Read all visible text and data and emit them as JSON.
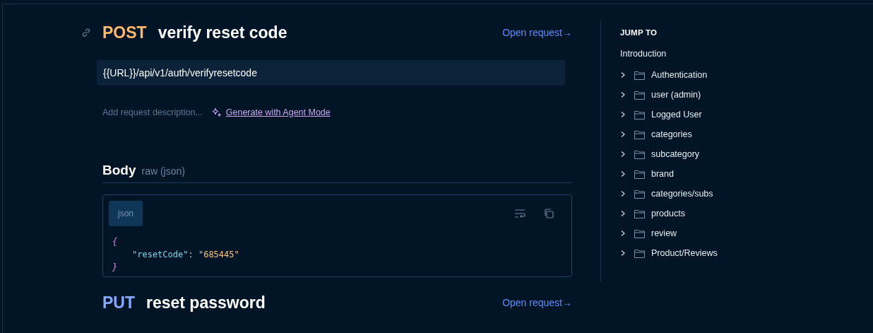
{
  "requests": [
    {
      "method": "POST",
      "name": "verify reset code",
      "open_link": "Open request→",
      "url": "{{URL}}/api/v1/auth/verifyresetcode",
      "description_placeholder": "Add request description...",
      "agent_link": "Generate with Agent Mode",
      "body": {
        "title": "Body",
        "mode": "raw (json)",
        "language": "json",
        "lines": [
          [
            {
              "kind": "brace",
              "text": "{"
            }
          ],
          [
            {
              "kind": "key",
              "text": "\"resetCode\""
            },
            {
              "kind": "punct",
              "text": ": "
            },
            {
              "kind": "string",
              "text": "\"685445\""
            }
          ],
          [
            {
              "kind": "brace",
              "text": "}"
            }
          ]
        ]
      }
    },
    {
      "method": "PUT",
      "name": "reset password",
      "open_link": "Open request→"
    }
  ],
  "sidebar": {
    "heading": "JUMP TO",
    "intro": "Introduction",
    "items": [
      {
        "label": "Authentication",
        "expanded": false
      },
      {
        "label": "user (admin)",
        "expanded": false
      },
      {
        "label": "Logged User",
        "expanded": false
      },
      {
        "label": "categories",
        "expanded": false
      },
      {
        "label": "subcategory",
        "expanded": false
      },
      {
        "label": "brand",
        "expanded": false
      },
      {
        "label": "categories/subs",
        "expanded": false
      },
      {
        "label": "products",
        "expanded": false
      },
      {
        "label": "review",
        "expanded": false
      },
      {
        "label": "Product/Reviews",
        "expanded": false
      }
    ]
  }
}
